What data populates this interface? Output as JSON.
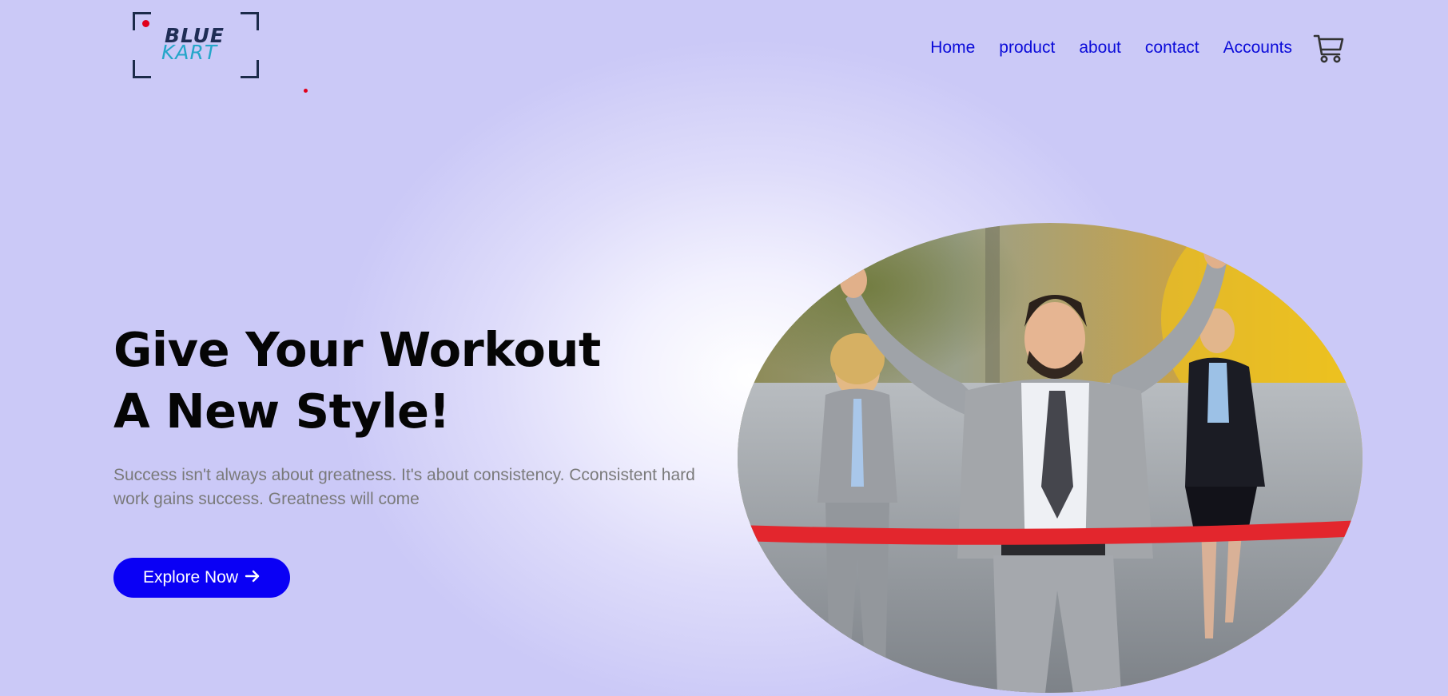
{
  "brand": {
    "line1": "BLUE",
    "line2": "KART",
    "colors": {
      "line1": "#1f2d55",
      "line2": "#24a6c9",
      "rec_dot": "#e0001b"
    }
  },
  "nav": {
    "items": [
      {
        "label": "Home"
      },
      {
        "label": "product"
      },
      {
        "label": "about"
      },
      {
        "label": "contact"
      },
      {
        "label": "Accounts"
      }
    ],
    "cart_icon": "shopping-cart-icon"
  },
  "hero": {
    "title_line1": "Give Your Workout",
    "title_line2": "A New Style!",
    "subtitle": "Success isn't always about greatness. It's about consistency. Cconsistent hard work gains success. Greatness will come",
    "cta_label": "Explore Now",
    "cta_icon": "arrow-right-icon",
    "image_icon": "business-race-photo"
  },
  "colors": {
    "accent": "#0a00f5",
    "nav_link": "#0b0bd9",
    "background": "#c9c7f6",
    "subtitle": "#7a7a7a"
  }
}
